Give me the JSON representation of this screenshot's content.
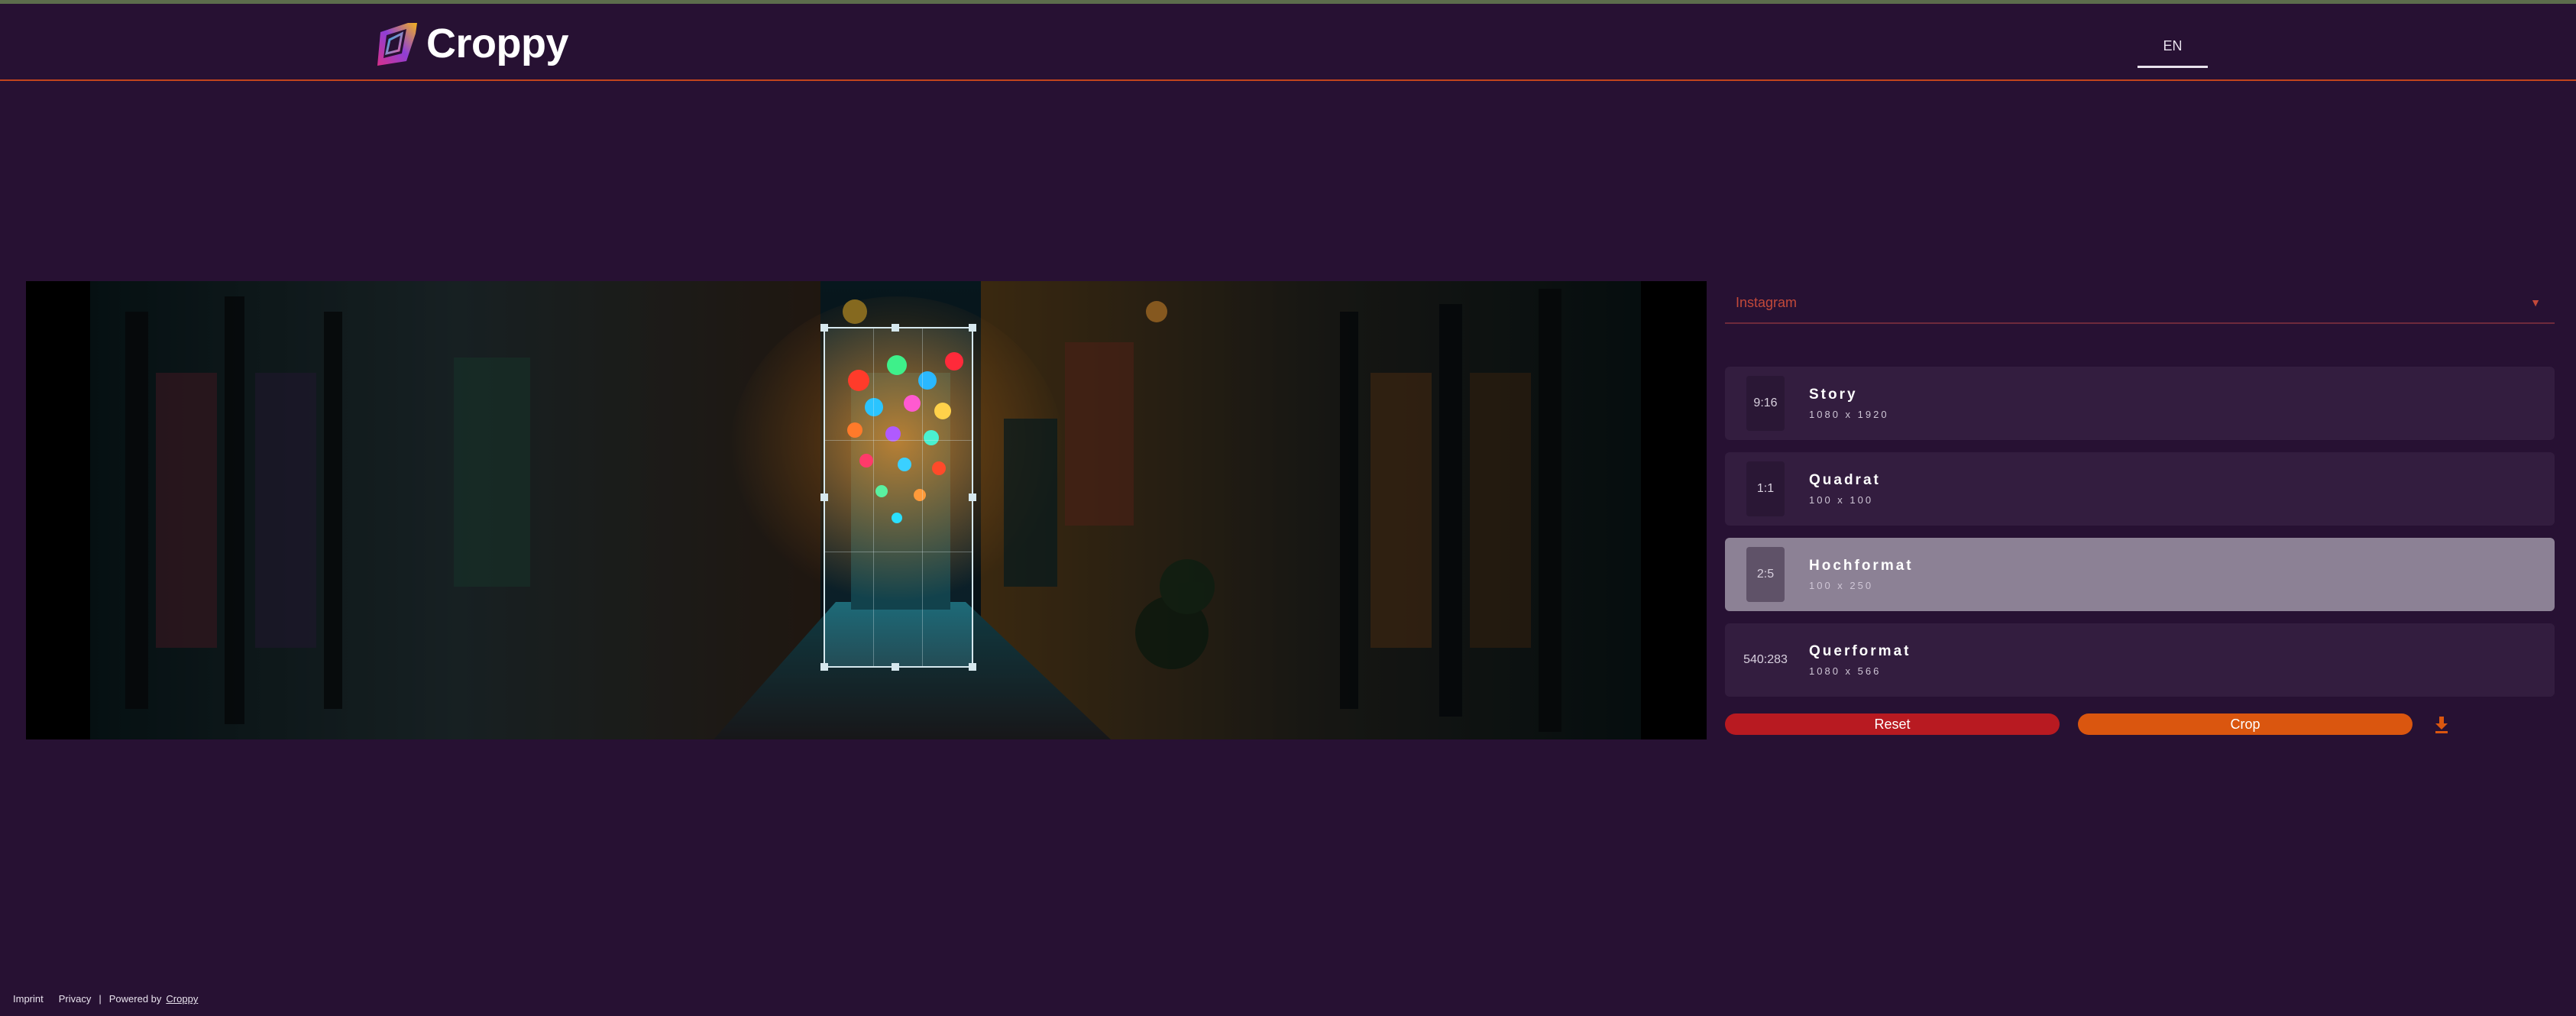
{
  "brand": {
    "name": "Croppy"
  },
  "header": {
    "language": "EN"
  },
  "platform_select": {
    "value": "Instagram"
  },
  "formats": [
    {
      "ratio": "9:16",
      "name": "Story",
      "size": "1080 x 1920",
      "active": false
    },
    {
      "ratio": "1:1",
      "name": "Quadrat",
      "size": "100 x 100",
      "active": false
    },
    {
      "ratio": "2:5",
      "name": "Hochformat",
      "size": "100 x 250",
      "active": true
    },
    {
      "ratio": "540:283",
      "name": "Querformat",
      "size": "1080 x 566",
      "active": false
    }
  ],
  "actions": {
    "reset": "Reset",
    "crop": "Crop"
  },
  "footer": {
    "imprint": "Imprint",
    "privacy": "Privacy",
    "powered_by": "Powered by",
    "powered_link": "Croppy"
  },
  "colors": {
    "background": "#271133",
    "accent": "#da560f",
    "danger": "#b81a21",
    "selected": "#8c8195"
  },
  "icons": {
    "download": "download-icon",
    "caret": "chevron-down-icon"
  }
}
